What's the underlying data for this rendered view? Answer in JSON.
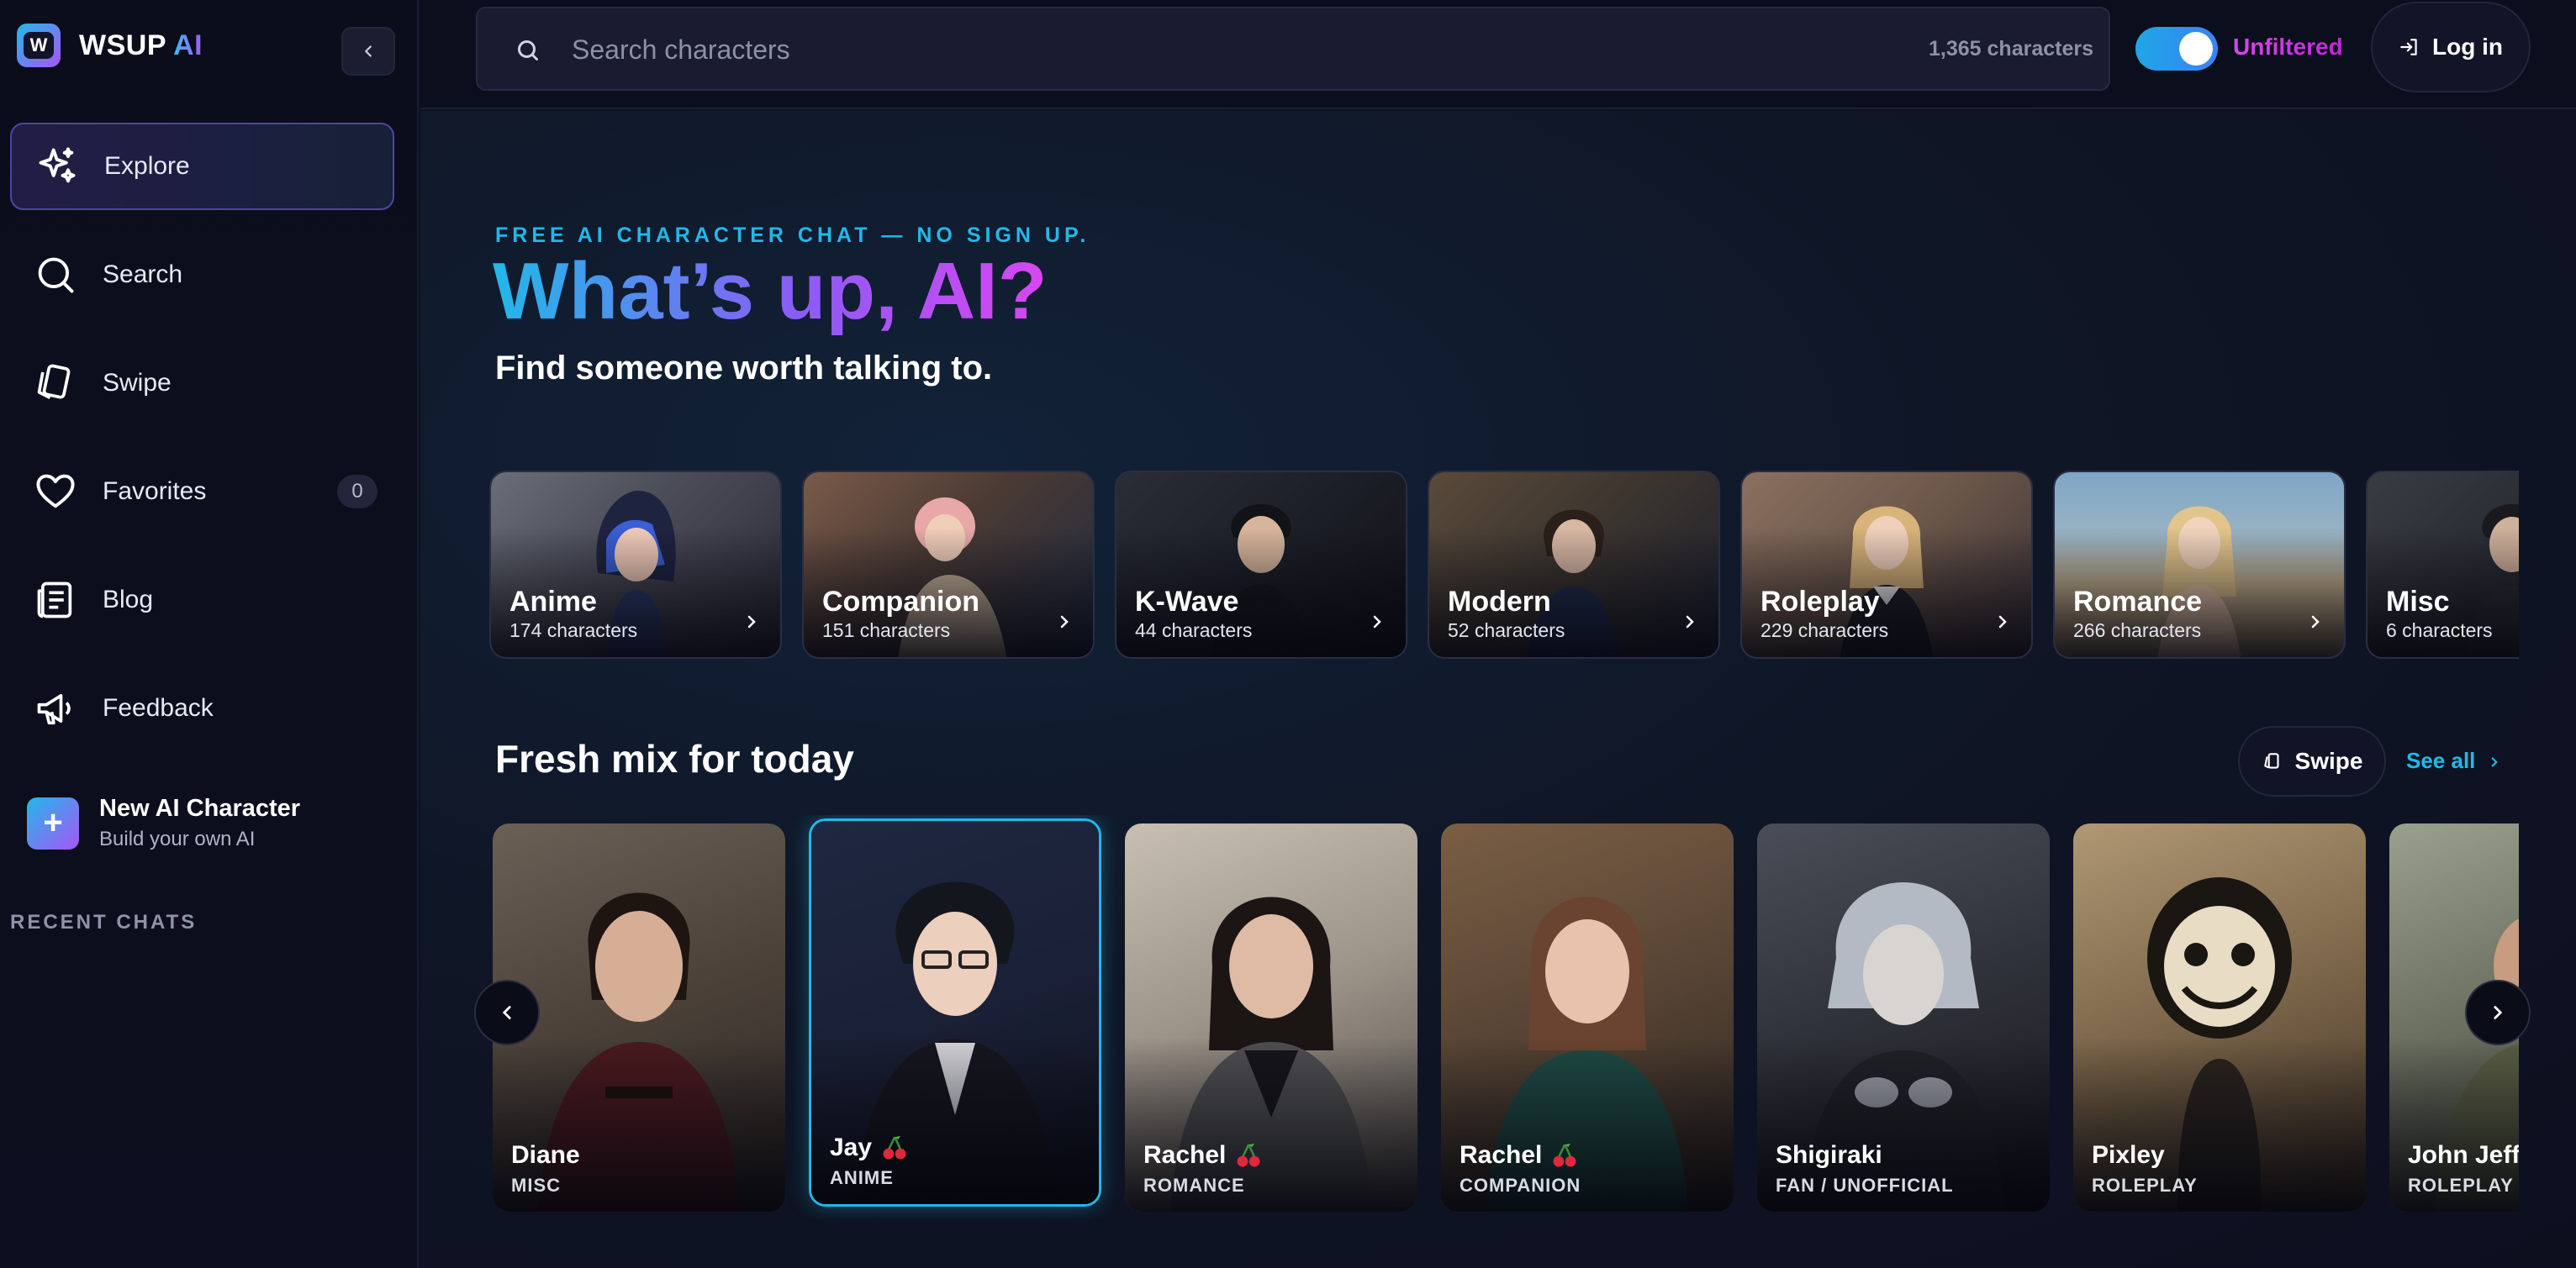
{
  "brand": {
    "name_main": "WSUP",
    "name_accent": "AI",
    "logo_letter": "W"
  },
  "sidebar": {
    "items": [
      {
        "label": "Explore",
        "icon": "sparkle-icon",
        "active": true
      },
      {
        "label": "Search",
        "icon": "search-icon"
      },
      {
        "label": "Swipe",
        "icon": "swipe-cards-icon"
      },
      {
        "label": "Favorites",
        "icon": "heart-icon",
        "count": "0"
      },
      {
        "label": "Blog",
        "icon": "newspaper-icon"
      },
      {
        "label": "Feedback",
        "icon": "megaphone-icon"
      }
    ],
    "new_character": {
      "title": "New AI Character",
      "subtitle": "Build your own AI"
    },
    "recent_heading": "RECENT CHATS"
  },
  "topbar": {
    "search_placeholder": "Search characters",
    "character_count": "1,365 characters",
    "toggle_on": true,
    "filter_label": "Unfiltered",
    "login_label": "Log in"
  },
  "hero": {
    "eyebrow": "FREE AI CHARACTER CHAT — NO SIGN UP.",
    "title": "What’s up, AI?",
    "subtitle": "Find someone worth talking to."
  },
  "categories": [
    {
      "name": "Anime",
      "count": "174 characters"
    },
    {
      "name": "Companion",
      "count": "151 characters"
    },
    {
      "name": "K-Wave",
      "count": "44 characters"
    },
    {
      "name": "Modern",
      "count": "52 characters"
    },
    {
      "name": "Roleplay",
      "count": "229 characters"
    },
    {
      "name": "Romance",
      "count": "266 characters"
    },
    {
      "name": "Misc",
      "count": "6 characters"
    }
  ],
  "fresh": {
    "title": "Fresh mix for today",
    "swipe_label": "Swipe",
    "see_all_label": "See all",
    "cards": [
      {
        "name": "Diane",
        "category": "MISC",
        "cherry": false
      },
      {
        "name": "Jay",
        "category": "ANIME",
        "cherry": true
      },
      {
        "name": "Rachel",
        "category": "ROMANCE",
        "cherry": true
      },
      {
        "name": "Rachel",
        "category": "COMPANION",
        "cherry": true
      },
      {
        "name": "Shigiraki",
        "category": "FAN / UNOFFICIAL",
        "cherry": false
      },
      {
        "name": "Pixley",
        "category": "ROLEPLAY",
        "cherry": false
      },
      {
        "name": "John Jeff",
        "category": "ROLEPLAY",
        "cherry": false
      }
    ]
  },
  "colors": {
    "accent_cyan": "#22b8e8",
    "accent_purple": "#a855f7",
    "accent_magenta": "#d946ef"
  }
}
